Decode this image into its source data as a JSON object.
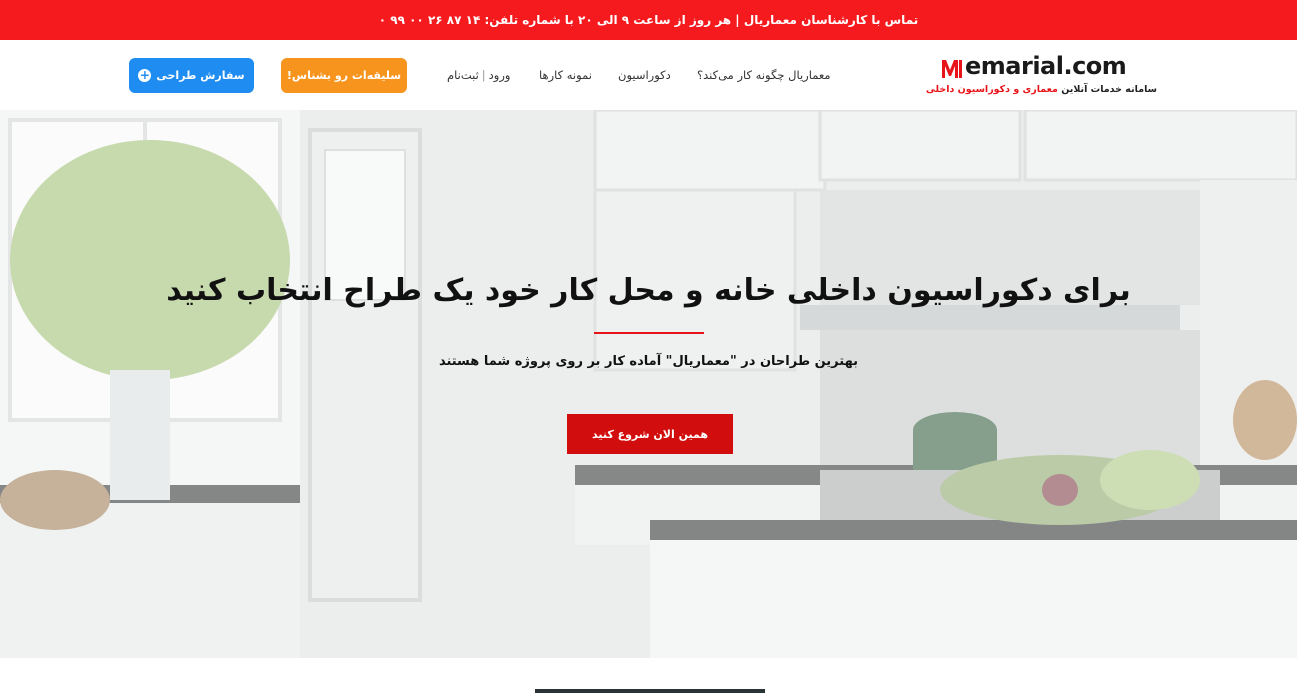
{
  "topbar": {
    "contact_text": "تماس با کارشناسان معماریال | هر روز از ساعت ۹ الی ۲۰ با شماره تلفن: ۱۴ ۸۷ ۲۶ ۰۰ ۹۹ ۰",
    "background": "#f41a1e"
  },
  "header": {
    "logo": {
      "text": "emarial.com",
      "tagline_prefix": "سامانه خدمات آنلاین ",
      "tagline_highlight": "معماری و دکوراسیون داخلی",
      "icon": "memarial-logo-icon"
    },
    "nav": {
      "how_it_works": "معماریال چگونه کار می‌کند؟",
      "decoration": "دکوراسیون",
      "samples": "نمونه کارها",
      "login": "ورود",
      "separator": "|",
      "register": "ثبت‌نام"
    },
    "buttons": {
      "style_quiz": "سلیقه‌ات رو بشناس!",
      "order_design": "سفارش طراحی",
      "order_icon": "plus-circle-icon"
    },
    "colors": {
      "orange": "#f7941d",
      "blue": "#1e8cf0"
    }
  },
  "hero": {
    "title": "برای دکوراسیون داخلی خانه و محل کار خود یک طراح انتخاب کنید",
    "subtitle": "بهترین طراحان در \"معماریال\" آماده کار بر روی پروژه شما هستند",
    "cta": "همین الان شروع کنید",
    "accent": "#d10d0d",
    "background_image": "kitchen-interior-photo"
  }
}
